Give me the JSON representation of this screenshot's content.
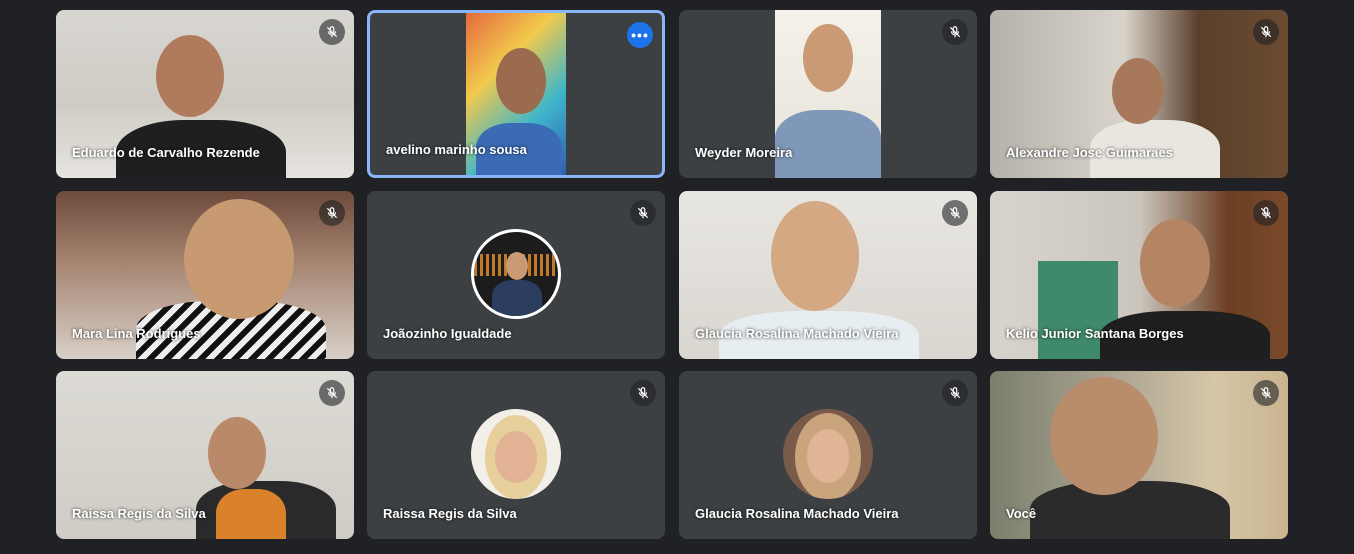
{
  "participants": [
    {
      "name": "Eduardo de Carvalho Rezende",
      "muted": true,
      "active": false
    },
    {
      "name": "avelino marinho sousa",
      "muted": false,
      "active": true,
      "more_label": "•••"
    },
    {
      "name": "Weyder Moreira",
      "muted": true,
      "active": false
    },
    {
      "name": "Alexandre Jose Guimaraes",
      "muted": true,
      "active": false
    },
    {
      "name": "Mara Lina Rodrigues",
      "muted": true,
      "active": false
    },
    {
      "name": "Joãozinho Igualdade",
      "muted": true,
      "active": false,
      "avatar": true
    },
    {
      "name": "Glaucia Rosalina Machado Vieira",
      "muted": true,
      "active": false
    },
    {
      "name": "Kelio Junior Santana Borges",
      "muted": true,
      "active": false
    },
    {
      "name": "Raissa Regis da Silva",
      "muted": true,
      "active": false
    },
    {
      "name": "Raissa Regis da Silva",
      "muted": true,
      "active": false,
      "avatar": true
    },
    {
      "name": "Glaucia Rosalina Machado Vieira",
      "muted": true,
      "active": false,
      "avatar": true
    },
    {
      "name": "Você",
      "muted": true,
      "active": false
    }
  ],
  "colors": {
    "background": "#202124",
    "tile": "#3c4043",
    "active_border": "#8ab4f8",
    "more_button": "#1a73e8"
  },
  "icons": {
    "muted": "mic-off-icon",
    "more": "more-options-icon"
  }
}
